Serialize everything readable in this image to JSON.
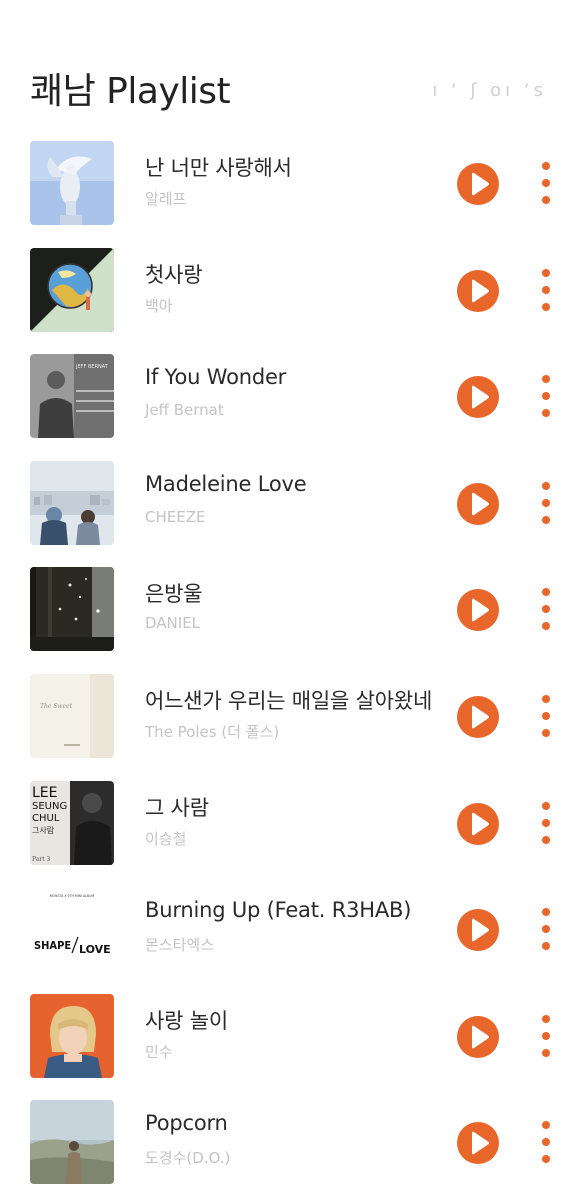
{
  "header": {
    "title": "쾌남 Playlist",
    "corner_text": "ı ʻ ʃ oı ʻs"
  },
  "theme": {
    "accent": "#e8662a",
    "title_color": "#222222",
    "artist_color": "#c4c4c4"
  },
  "songs": [
    {
      "title": "난 너만 사랑해서",
      "artist": "알레프",
      "art": "angel-statue-art"
    },
    {
      "title": "첫사랑",
      "artist": "백아",
      "art": "globe-art"
    },
    {
      "title": "If You Wonder",
      "artist": "Jeff Bernat",
      "art": "portrait-art"
    },
    {
      "title": "Madeleine Love",
      "artist": "CHEEZE",
      "art": "city-view-art"
    },
    {
      "title": "은방울",
      "artist": "DANIEL",
      "art": "dark-forest-art"
    },
    {
      "title": "어느샌가 우리는 매일을 살아왔네",
      "artist": "The Poles (더 폴스)",
      "art": "paper-art"
    },
    {
      "title": "그 사람",
      "artist": "이승철",
      "art": "lee-seung-chul-art"
    },
    {
      "title": "Burning Up (Feat. R3HAB)",
      "artist": "몬스타엑스",
      "art": "shape-of-love-art"
    },
    {
      "title": "사랑 놀이",
      "artist": "민수",
      "art": "girl-portrait-art"
    },
    {
      "title": "Popcorn",
      "artist": "도경수(D.O.)",
      "art": "field-art"
    }
  ],
  "art_text": {
    "jeff": "JEFF BERNAT",
    "lee_1": "LEE",
    "lee_2": "SEUNG",
    "lee_3": "CHUL",
    "lee_4": "그사람",
    "lee_5": "Part 3",
    "shape_1": "SHAPE",
    "shape_2": "LOVE",
    "shape_top": "MONSTA X 9TH MINI ALBUM",
    "poles": "The Sweet"
  }
}
